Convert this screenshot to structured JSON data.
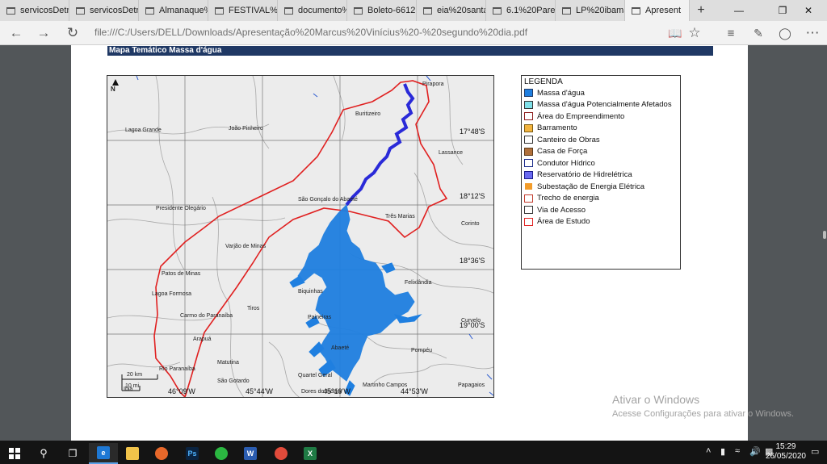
{
  "browser": {
    "tabs": [
      {
        "label": "servicosDetra"
      },
      {
        "label": "servicosDetra"
      },
      {
        "label": "Almanaque%"
      },
      {
        "label": "FESTIVAL%20"
      },
      {
        "label": "documento%"
      },
      {
        "label": "Boleto-66121("
      },
      {
        "label": "eia%20santa%"
      },
      {
        "label": "6.1%20Parece"
      },
      {
        "label": "LP%20ibama."
      },
      {
        "label": "Apresent",
        "active": true
      }
    ],
    "url": "file:///C:/Users/DELL/Downloads/Apresentação%20Marcus%20Vinícius%20-%20segundo%20dia.pdf"
  },
  "document": {
    "map_title": "Mapa Temático Massa d'água",
    "north_label": "N",
    "places": [
      {
        "name": "Pirapora"
      },
      {
        "name": "Buritizeiro"
      },
      {
        "name": "Lagoa Grande"
      },
      {
        "name": "João Pinheiro"
      },
      {
        "name": "Lassance"
      },
      {
        "name": "São Gonçalo do Abaeté"
      },
      {
        "name": "Presidente Olegário"
      },
      {
        "name": "Três Marias"
      },
      {
        "name": "Corinto"
      },
      {
        "name": "Varjão de Minas"
      },
      {
        "name": "Patos de Minas"
      },
      {
        "name": "Felixlândia"
      },
      {
        "name": "Biquinhas"
      },
      {
        "name": "Lagoa Formosa"
      },
      {
        "name": "Tiros"
      },
      {
        "name": "Carmo do Paranaíba"
      },
      {
        "name": "Paineiras"
      },
      {
        "name": "Curvelo"
      },
      {
        "name": "Arapuá"
      },
      {
        "name": "Abaeté"
      },
      {
        "name": "Pompéu"
      },
      {
        "name": "Rio Paranaíba"
      },
      {
        "name": "Matutina"
      },
      {
        "name": "Quartel Geral"
      },
      {
        "name": "São Gotardo"
      },
      {
        "name": "Martinho Campos"
      },
      {
        "name": "Papagaios"
      },
      {
        "name": "Ibiá"
      },
      {
        "name": "Dores do Indaiá"
      }
    ],
    "lat_labels": [
      "17°48'S",
      "18°12'S",
      "18°36'S",
      "19°00'S"
    ],
    "lon_labels": [
      "46°09'W",
      "45°44'W",
      "45°19'W",
      "44°53'W"
    ],
    "scalebar": {
      "km": "20 km",
      "mi": "10 mi"
    },
    "legend": {
      "title": "LEGENDA",
      "items": [
        {
          "label": "Massa d'água",
          "fill": "#1f7fe0",
          "border": "#1f3864"
        },
        {
          "label": "Massa d'água Potencialmente Afetados",
          "fill": "#7fe0e8",
          "border": "#333333"
        },
        {
          "label": "Área do Empreendimento",
          "fill": "#ffffff",
          "border": "#8b1a1a"
        },
        {
          "label": "Barramento",
          "fill": "#f3b43f",
          "border": "#7a5a10"
        },
        {
          "label": "Canteiro de Obras",
          "fill": "#ffffff",
          "border": "#333333"
        },
        {
          "label": "Casa de Força",
          "fill": "#b0703a",
          "border": "#5b3a1a"
        },
        {
          "label": "Condutor Hídrico",
          "fill": "#ffffff",
          "border": "#1a2a8a"
        },
        {
          "label": "Reservatório de Hidrelétrica",
          "fill": "#6a6af0",
          "border": "#1a1a8a"
        },
        {
          "label": "Subestação de Energia Elétrica",
          "fill": "#f39c2a",
          "border": "#ffffff"
        },
        {
          "label": "Trecho de energia",
          "fill": "#ffffff",
          "border": "#c0392b"
        },
        {
          "label": "Via de Acesso",
          "fill": "#ffffff",
          "border": "#333333"
        },
        {
          "label": "Área de Estudo",
          "fill": "#ffffff",
          "border": "#e02020"
        }
      ]
    }
  },
  "watermark": {
    "line1": "Ativar o Windows",
    "line2": "Acesse Configurações para ativar o Windows."
  },
  "taskbar": {
    "time": "15:29",
    "date": "26/05/2020"
  }
}
